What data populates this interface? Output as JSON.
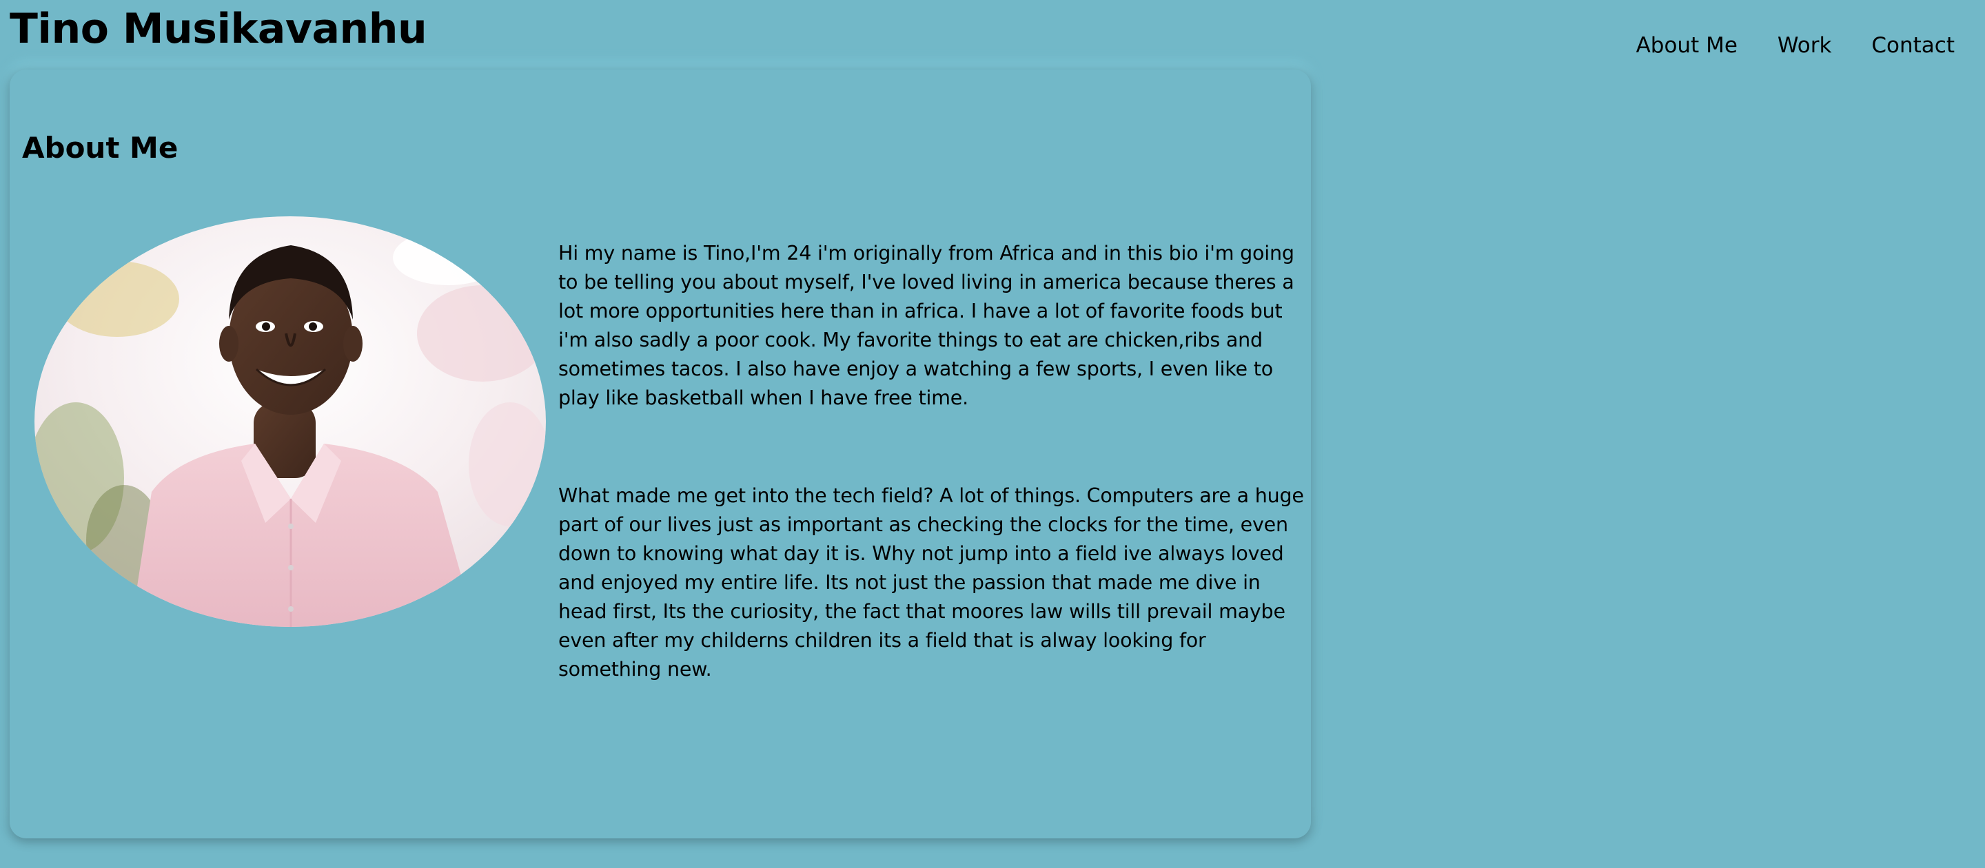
{
  "header": {
    "site_title": "Tino Musikavanhu",
    "nav": [
      "About Me",
      "Work",
      "Contact"
    ]
  },
  "main": {
    "heading": "About Me",
    "paragraphs": [
      "Hi my name is Tino,I'm 24 i'm originally from Africa and in this bio i'm going to be telling you about myself, I've loved living in america because theres a lot more opportunities here than in africa. I have a lot of favorite foods but i'm also sadly a poor cook. My favorite things to eat are chicken,ribs and sometimes tacos. I also have enjoy a watching a few sports, I even like to play like basketball when I have free time.",
      "What made me get into the tech field? A lot of things. Computers are a huge part of our lives just as important as checking the clocks for the time, even down to knowing what day it is. Why not jump into a field ive always loved and enjoyed my entire life. Its not just the passion that made me dive in head first, Its the curiosity, the fact that moores law wills till prevail maybe even after my childerns children its a field that is alway looking for something new."
    ]
  },
  "colors": {
    "background": "#72b8c8",
    "text": "#000000"
  }
}
